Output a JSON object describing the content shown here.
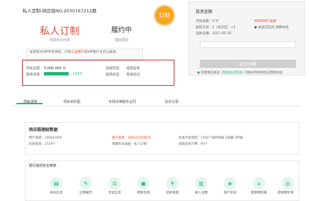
{
  "product": {
    "title": "私人定制-供应链NO.2030167212期",
    "main_title": "私人订制",
    "rate_label": "预期年化利率",
    "status": "履约中",
    "status_label": "理财期限",
    "seal": "订制",
    "notice_pre": "该项目为VIP专享项目，只有",
    "notice_link": "认证用户",
    "notice_post": "的VIP用户才可以投资。",
    "amount_label": "项目总额",
    "amount_value": "5,000,000 元",
    "progress_label": "融资进度",
    "progress_value": 100,
    "progress_text": "100%",
    "guarantees": [
      "担保风险",
      "借款监管",
      "超高收益",
      "极速返还"
    ]
  },
  "invest_panel": {
    "title": "投资金额",
    "available_label": "可投金额：0 元",
    "available_value": "5000000 起投",
    "min_label": "起投方式：1（成交区）+1",
    "increment_label": "● 按成交区间 到期本息",
    "date_label": "还款日期：2017-05-16",
    "amount_placeholder": "",
    "invest_button": "投资已满额",
    "agree_pre": "同意我已阅读《",
    "agree_link": "借款协议范本",
    "agree_post": "》的格式和条款生成借款协议"
  },
  "tabs": [
    {
      "label": "项目详情"
    },
    {
      "label": "项目资料图"
    },
    {
      "label": "专网法律服务合同"
    },
    {
      "label": "投资记录"
    }
  ],
  "info": {
    "title": "供应链理财数据",
    "row1": [
      "用户等级：2805639次",
      "累计投资：1944315586元",
      "还本付息待回：1502个按时到账 0逾期 0坏账"
    ],
    "row2": [
      "历史投资：2539个",
      "预期年化收益：私人订制",
      "借款还本计算：90个"
    ]
  },
  "security": {
    "title": "银行级别安全审核",
    "items": [
      "身份信息",
      "信用报告",
      "涉诉信息",
      "借款合同",
      "还款来源",
      "收入证明",
      "资产状况",
      "担保物权属",
      "担保物价值"
    ]
  }
}
